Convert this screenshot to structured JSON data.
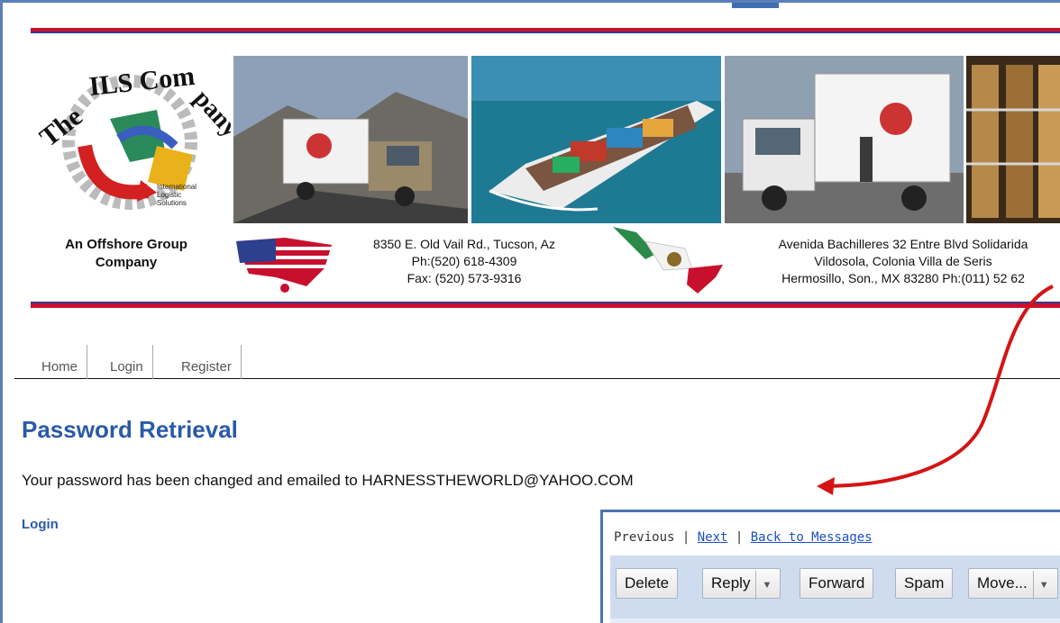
{
  "header": {
    "logo_top": "The ILS Company",
    "logo_small": "International Logistic Solutions",
    "tagline": "An Offshore Group Company",
    "us_address": {
      "line1": "8350 E. Old Vail Rd., Tucson, Az",
      "line2": "Ph:(520) 618-4309",
      "line3": "Fax: (520) 573-9316"
    },
    "mx_address": {
      "line1": "Avenida Bachilleres 32 Entre Blvd Solidarida",
      "line2": "Vildosola, Colonia Villa de Seris",
      "line3": "Hermosillo, Son., MX 83280 Ph:(011) 52 62"
    }
  },
  "nav": {
    "items": [
      {
        "label": "Home"
      },
      {
        "label": "Login"
      },
      {
        "label": "Register"
      }
    ]
  },
  "main": {
    "title": "Password Retrieval",
    "message": "Your password has been changed and emailed to HARNESSTHEWORLD@YAHOO.COM",
    "login_link": "Login"
  },
  "mail_inset": {
    "prev_label": "Previous",
    "next_label": "Next",
    "back_label": "Back to Messages",
    "buttons": {
      "delete": "Delete",
      "reply": "Reply",
      "forward": "Forward",
      "spam": "Spam",
      "move": "Move..."
    }
  },
  "colors": {
    "accent_red": "#c8102e",
    "accent_blue": "#2d3f8f",
    "title_blue": "#2a5aa8",
    "link_blue": "#1a4fc8"
  }
}
